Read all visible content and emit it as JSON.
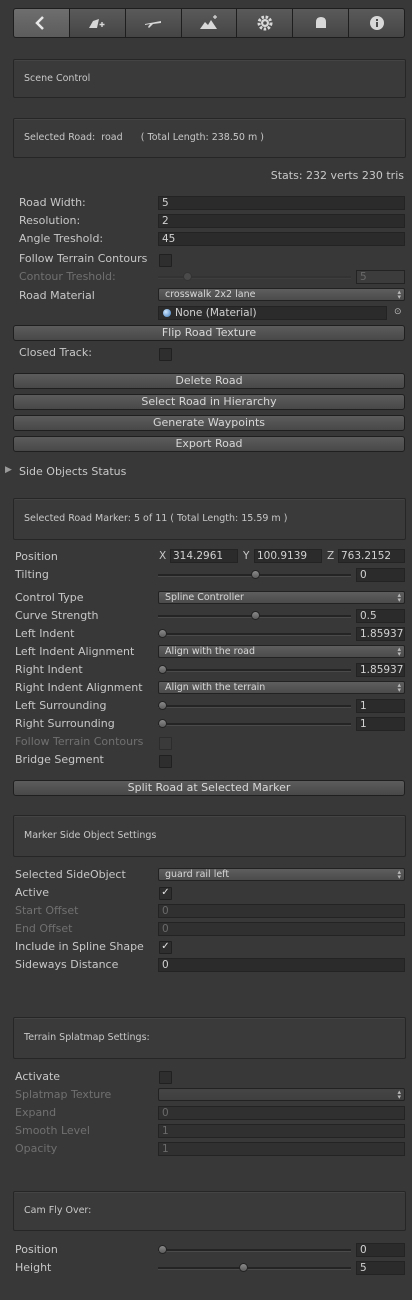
{
  "toolbar": {
    "buttons": [
      {
        "icon": "back-arrow-icon"
      },
      {
        "icon": "add-road-icon"
      },
      {
        "icon": "airplane-icon"
      },
      {
        "icon": "terrain-edit-icon"
      },
      {
        "icon": "gear-icon"
      },
      {
        "icon": "bell-icon"
      },
      {
        "icon": "info-icon"
      }
    ]
  },
  "scene_control": {
    "title": "Scene Control"
  },
  "road_info": {
    "selected_label": "Selected Road:",
    "road_name": "road",
    "total_length": "( Total Length: 238.50 m )"
  },
  "stats": "Stats: 232 verts 230 tris",
  "road": {
    "width_label": "Road Width:",
    "width": "5",
    "resolution_label": "Resolution:",
    "resolution": "2",
    "angle_label": "Angle Treshold:",
    "angle": "45",
    "follow_label": "Follow Terrain Contours",
    "contour_label": "Contour Treshold:",
    "contour_value": "5",
    "contour_slider": 0.15,
    "material_label": "Road Material",
    "material_selected": "crosswalk 2x2 lane",
    "material_object": "None (Material)",
    "flip_button": "Flip Road Texture",
    "closed_label": "Closed Track:"
  },
  "actions": {
    "delete": "Delete Road",
    "select": "Select Road in Hierarchy",
    "waypoints": "Generate Waypoints",
    "export": "Export Road"
  },
  "side_objects_status": "Side Objects Status",
  "marker_info": "Selected Road Marker: 5 of 11  ( Total Length: 15.59 m )",
  "marker": {
    "position_label": "Position",
    "x_label": "X",
    "x": "314.2961",
    "y_label": "Y",
    "y": "100.9139",
    "z_label": "Z",
    "z": "763.2152",
    "tilting_label": "Tilting",
    "tilting": "0",
    "tilting_slider": 0.5,
    "control_type_label": "Control Type",
    "control_type": "Spline Controller",
    "curve_label": "Curve Strength",
    "curve": "0.5",
    "curve_slider": 0.5,
    "left_indent_label": "Left Indent",
    "left_indent": "1.85937",
    "left_indent_slider": 0.02,
    "left_align_label": "Left Indent Alignment",
    "left_align": "Align with the road",
    "right_indent_label": "Right Indent",
    "right_indent": "1.85937",
    "right_indent_slider": 0.02,
    "right_align_label": "Right Indent Alignment",
    "right_align": "Align with the terrain",
    "left_surround_label": "Left Surrounding",
    "left_surround": "1",
    "left_surround_slider": 0.02,
    "right_surround_label": "Right Surrounding",
    "right_surround": "1",
    "right_surround_slider": 0.02,
    "follow_label": "Follow Terrain Contours",
    "bridge_label": "Bridge Segment",
    "split_button": "Split Road at Selected Marker"
  },
  "side_object_settings": {
    "title": "Marker Side Object Settings",
    "selected_label": "Selected SideObject",
    "selected": "guard rail left",
    "active_label": "Active",
    "start_label": "Start Offset",
    "start": "0",
    "end_label": "End Offset",
    "end": "0",
    "include_label": "Include in Spline Shape",
    "sideways_label": "Sideways Distance",
    "sideways": "0"
  },
  "splatmap": {
    "title": "Terrain Splatmap Settings:",
    "activate_label": "Activate",
    "texture_label": "Splatmap Texture",
    "expand_label": "Expand",
    "expand": "0",
    "smooth_label": "Smooth Level",
    "smooth": "1",
    "opacity_label": "Opacity",
    "opacity": "1"
  },
  "cam": {
    "title": "Cam Fly Over:",
    "position_label": "Position",
    "position": "0",
    "position_slider": 0.02,
    "height_label": "Height",
    "height": "5",
    "height_slider": 0.44
  }
}
